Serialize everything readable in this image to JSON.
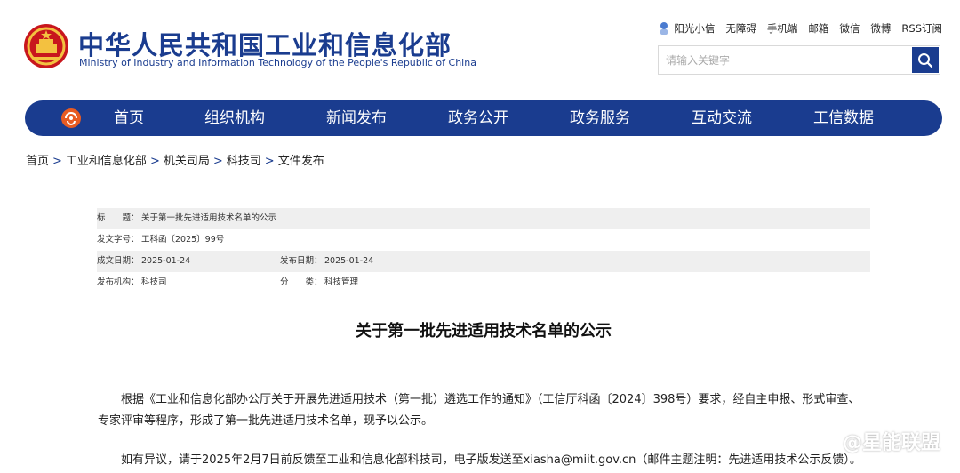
{
  "header": {
    "title_cn": "中华人民共和国工业和信息化部",
    "title_en": "Ministry of Industry and Information Technology of the People's Republic of China",
    "emblem_icon": "national-emblem-icon",
    "brand_color": "#1a3c8f",
    "links": [
      "阳光小信",
      "无障碍",
      "手机端",
      "邮箱",
      "微信",
      "微博",
      "RSS订阅"
    ],
    "search": {
      "placeholder": "请输入关键字",
      "icon": "search-icon"
    }
  },
  "nav": {
    "items": [
      "首页",
      "组织机构",
      "新闻发布",
      "政务公开",
      "政务服务",
      "互动交流",
      "工信数据"
    ]
  },
  "breadcrumb": [
    "首页",
    "工业和信息化部",
    "机关司局",
    "科技司",
    "文件发布"
  ],
  "info": {
    "title_label": "标　　题：",
    "title_value": "关于第一批先进适用技术名单的公示",
    "doc_no_label": "发文字号：",
    "doc_no_value": "工科函〔2025〕99号",
    "date_label": "成文日期：",
    "date_value": "2025-01-24",
    "pub_date_label": "发布日期：",
    "pub_date_value": "2025-01-24",
    "org_label": "发布机构：",
    "org_value": "科技司",
    "category_label": "分　　类：",
    "category_value": "科技管理"
  },
  "article": {
    "title": "关于第一批先进适用技术名单的公示",
    "para1": "根据《工业和信息化部办公厅关于开展先进适用技术（第一批）遴选工作的通知》（工信厅科函〔2024〕398号）要求，经自主申报、形式审查、专家评审等程序，形成了第一批先进适用技术名单，现予以公示。",
    "para2": "如有异议，请于2025年2月7日前反馈至工业和信息化部科技司，电子版发送至xiasha@miit.gov.cn（邮件主题注明：先进适用技术公示反馈）。"
  },
  "watermark": "@星能联盟"
}
